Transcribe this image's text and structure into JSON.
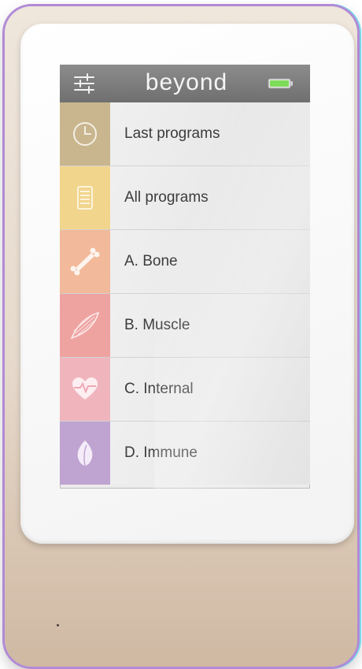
{
  "app": {
    "logo_text": "beyond",
    "battery_color": "#7fdc5a"
  },
  "menu": {
    "items": [
      {
        "label": "Last programs",
        "icon": "clock-icon",
        "color": "#c9b68f"
      },
      {
        "label": "All programs",
        "icon": "list-icon",
        "color": "#f2d58d"
      },
      {
        "label": "A.  Bone",
        "icon": "bone-icon",
        "color": "#f2b99a"
      },
      {
        "label": "B.  Muscle",
        "icon": "muscle-icon",
        "color": "#eea3a1"
      },
      {
        "label": "C.  Internal",
        "icon": "heart-pulse-icon",
        "color": "#f0b4bd"
      },
      {
        "label": "D.  Immune",
        "icon": "leaf-icon",
        "color": "#bfa3d1"
      }
    ]
  }
}
